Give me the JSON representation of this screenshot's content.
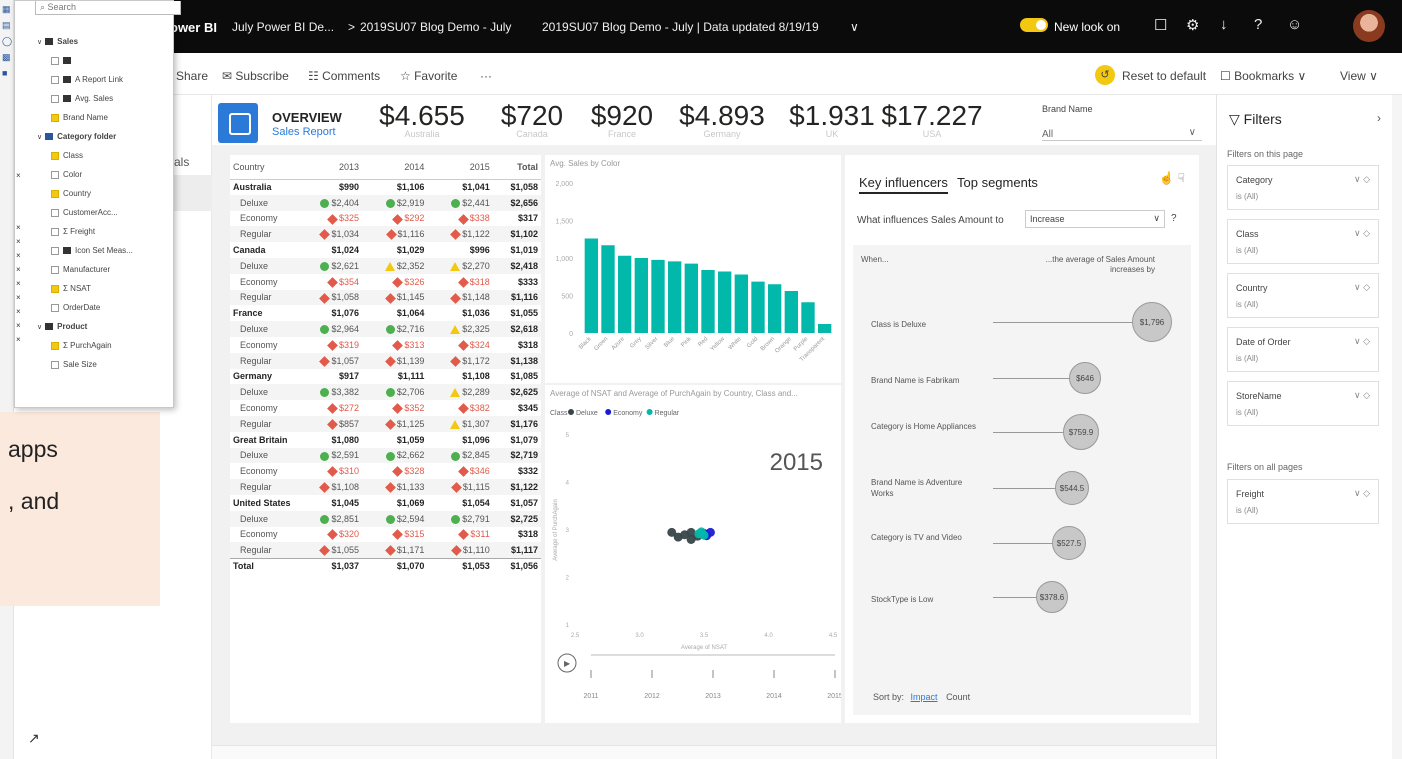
{
  "topbar": {
    "brand": "ower BI",
    "crumb1": "July Power BI De...",
    "crumb_sep": ">",
    "crumb2": "2019SU07 Blog Demo - July",
    "report_title": "2019SU07 Blog Demo - July | Data updated 8/19/19",
    "title_chevron": "∨",
    "new_look": "New look on",
    "icons": [
      "chat-icon",
      "gear-icon",
      "download-icon",
      "help-icon",
      "smiley-icon"
    ],
    "icon_glyphs": [
      "☐",
      "⚙",
      "↓",
      "?",
      "☺"
    ]
  },
  "actionbar": {
    "share": "Share",
    "subscribe": "✉ Subscribe",
    "comments": "☷ Comments",
    "favorite": "☆ Favorite",
    "more": "···",
    "reset_icon": "↺",
    "reset": "Reset to default",
    "bookmarks": "☐ Bookmarks ∨",
    "view": "View ∨"
  },
  "rail": {
    "partial_label": "als",
    "corner_arrow": "↗"
  },
  "fields_pane": {
    "search_placeholder": "⌕ Search",
    "rows": [
      {
        "label": "Sales",
        "kind": "table-header",
        "check": "none"
      },
      {
        "label": "",
        "kind": "item",
        "check": "table"
      },
      {
        "label": "A Report Link",
        "kind": "item",
        "check": "table"
      },
      {
        "label": "Avg. Sales",
        "kind": "item",
        "check": "table"
      },
      {
        "label": "Brand Name",
        "kind": "item",
        "check": "on"
      },
      {
        "label": "Category folder",
        "kind": "folder",
        "check": "none"
      },
      {
        "label": "Class",
        "kind": "item",
        "check": "on"
      },
      {
        "label": "Color",
        "kind": "item",
        "check": "off"
      },
      {
        "label": "Country",
        "kind": "item",
        "check": "on"
      },
      {
        "label": "CustomerAcc...",
        "kind": "item",
        "check": "off"
      },
      {
        "label": "Σ Freight",
        "kind": "item",
        "check": "off"
      },
      {
        "label": "Icon Set Meas...",
        "kind": "item",
        "check": "table"
      },
      {
        "label": "Manufacturer",
        "kind": "item",
        "check": "off"
      },
      {
        "label": "Σ NSAT",
        "kind": "item",
        "check": "on"
      },
      {
        "label": "OrderDate",
        "kind": "item",
        "check": "off"
      },
      {
        "label": "Product",
        "kind": "table-header",
        "check": "none"
      },
      {
        "label": "Σ PurchAgain",
        "kind": "item",
        "check": "on"
      },
      {
        "label": "Sale Size",
        "kind": "item",
        "check": "off"
      }
    ]
  },
  "beige_card": {
    "lines": [
      "apps",
      ", and"
    ]
  },
  "header": {
    "title": "OVERVIEW",
    "subtitle": "Sales Report",
    "kpis": [
      {
        "value": "$4.655",
        "label": "Australia"
      },
      {
        "value": "$720",
        "label": "Canada"
      },
      {
        "value": "$920",
        "label": "France"
      },
      {
        "value": "$4.893",
        "label": "Germany"
      },
      {
        "value": "$1.931",
        "label": "UK"
      },
      {
        "value": "$17.227",
        "label": "USA"
      }
    ],
    "brand_label": "Brand Name",
    "brand_value": "All",
    "brand_chevron": "∨"
  },
  "matrix": {
    "headers": [
      "Country",
      "2013",
      "2014",
      "2015",
      "Total"
    ],
    "rows": [
      {
        "type": "country",
        "cells": [
          "Australia",
          "$990",
          "$1,106",
          "$1,041",
          "$1,058"
        ]
      },
      {
        "type": "sub",
        "cells": [
          "Deluxe",
          "$2,404",
          "$2,919",
          "$2,441",
          "$2,656"
        ],
        "icons": [
          "g",
          "g",
          "g"
        ]
      },
      {
        "type": "sub",
        "cells": [
          "Economy",
          "$325",
          "$292",
          "$338",
          "$317"
        ],
        "icons": [
          "r",
          "r",
          "r"
        ]
      },
      {
        "type": "sub",
        "cells": [
          "Regular",
          "$1,034",
          "$1,116",
          "$1,122",
          "$1,102"
        ],
        "icons": [
          "r",
          "r",
          "r"
        ]
      },
      {
        "type": "country",
        "cells": [
          "Canada",
          "$1,024",
          "$1,029",
          "$996",
          "$1,019"
        ]
      },
      {
        "type": "sub",
        "cells": [
          "Deluxe",
          "$2,621",
          "$2,352",
          "$2,270",
          "$2,418"
        ],
        "icons": [
          "g",
          "y",
          "y"
        ]
      },
      {
        "type": "sub",
        "cells": [
          "Economy",
          "$354",
          "$326",
          "$318",
          "$333"
        ],
        "icons": [
          "r",
          "r",
          "r"
        ]
      },
      {
        "type": "sub",
        "cells": [
          "Regular",
          "$1,058",
          "$1,145",
          "$1,148",
          "$1,116"
        ],
        "icons": [
          "r",
          "r",
          "r"
        ]
      },
      {
        "type": "country",
        "cells": [
          "France",
          "$1,076",
          "$1,064",
          "$1,036",
          "$1,055"
        ]
      },
      {
        "type": "sub",
        "cells": [
          "Deluxe",
          "$2,964",
          "$2,716",
          "$2,325",
          "$2,618"
        ],
        "icons": [
          "g",
          "g",
          "y"
        ]
      },
      {
        "type": "sub",
        "cells": [
          "Economy",
          "$319",
          "$313",
          "$324",
          "$318"
        ],
        "icons": [
          "r",
          "r",
          "r"
        ]
      },
      {
        "type": "sub",
        "cells": [
          "Regular",
          "$1,057",
          "$1,139",
          "$1,172",
          "$1,138"
        ],
        "icons": [
          "r",
          "r",
          "r"
        ]
      },
      {
        "type": "country",
        "cells": [
          "Germany",
          "$917",
          "$1,111",
          "$1,108",
          "$1,085"
        ]
      },
      {
        "type": "sub",
        "cells": [
          "Deluxe",
          "$3,382",
          "$2,706",
          "$2,289",
          "$2,625"
        ],
        "icons": [
          "g",
          "g",
          "y"
        ]
      },
      {
        "type": "sub",
        "cells": [
          "Economy",
          "$272",
          "$352",
          "$382",
          "$345"
        ],
        "icons": [
          "r",
          "r",
          "r"
        ]
      },
      {
        "type": "sub",
        "cells": [
          "Regular",
          "$857",
          "$1,125",
          "$1,307",
          "$1,176"
        ],
        "icons": [
          "r",
          "r",
          "y"
        ]
      },
      {
        "type": "country",
        "cells": [
          "Great Britain",
          "$1,080",
          "$1,059",
          "$1,096",
          "$1,079"
        ]
      },
      {
        "type": "sub",
        "cells": [
          "Deluxe",
          "$2,591",
          "$2,662",
          "$2,845",
          "$2,719"
        ],
        "icons": [
          "g",
          "g",
          "g"
        ]
      },
      {
        "type": "sub",
        "cells": [
          "Economy",
          "$310",
          "$328",
          "$346",
          "$332"
        ],
        "icons": [
          "r",
          "r",
          "r"
        ]
      },
      {
        "type": "sub",
        "cells": [
          "Regular",
          "$1,108",
          "$1,133",
          "$1,115",
          "$1,122"
        ],
        "icons": [
          "r",
          "r",
          "r"
        ]
      },
      {
        "type": "country",
        "cells": [
          "United States",
          "$1,045",
          "$1,069",
          "$1,054",
          "$1,057"
        ]
      },
      {
        "type": "sub",
        "cells": [
          "Deluxe",
          "$2,851",
          "$2,594",
          "$2,791",
          "$2,725"
        ],
        "icons": [
          "g",
          "g",
          "g"
        ]
      },
      {
        "type": "sub",
        "cells": [
          "Economy",
          "$320",
          "$315",
          "$311",
          "$318"
        ],
        "icons": [
          "r",
          "r",
          "r"
        ]
      },
      {
        "type": "sub",
        "cells": [
          "Regular",
          "$1,055",
          "$1,171",
          "$1,110",
          "$1,117"
        ],
        "icons": [
          "r",
          "r",
          "r"
        ]
      },
      {
        "type": "grand",
        "cells": [
          "Total",
          "$1,037",
          "$1,070",
          "$1,053",
          "$1,056"
        ]
      }
    ]
  },
  "chart_data": [
    {
      "type": "bar",
      "title": "Avg. Sales by Color",
      "categories": [
        "Black",
        "Green",
        "Azure",
        "Grey",
        "Silver",
        "Blue",
        "Pink",
        "Red",
        "Yellow",
        "White",
        "Gold",
        "Brown",
        "Orange",
        "Purple",
        "Transparent"
      ],
      "values": [
        1260,
        1170,
        1030,
        1000,
        975,
        955,
        925,
        840,
        820,
        780,
        685,
        650,
        560,
        410,
        120
      ],
      "ylim": [
        0,
        2000
      ],
      "yticks": [
        "0",
        "500",
        "1,000",
        "1,500",
        "2,000"
      ],
      "color": "#01b8aa"
    },
    {
      "type": "scatter",
      "title": "Average of NSAT and Average of PurchAgain by Country, Class and...",
      "legend_title": "Class",
      "legend": [
        {
          "name": "Deluxe",
          "color": "#374649"
        },
        {
          "name": "Economy",
          "color": "#1b1bd1"
        },
        {
          "name": "Regular",
          "color": "#01b8aa"
        }
      ],
      "play_year": "2015",
      "xlabel": "Average of NSAT",
      "ylabel": "Average of PurchAgain",
      "xlim": [
        2.5,
        4.5
      ],
      "ylim": [
        1,
        5
      ],
      "xticks": [
        "2.5",
        "3.0",
        "3.5",
        "4.0",
        "4.5"
      ],
      "yticks": [
        "1",
        "2",
        "3",
        "4",
        "5"
      ],
      "points": [
        {
          "x": 3.25,
          "y": 2.95,
          "c": "Deluxe"
        },
        {
          "x": 3.3,
          "y": 2.85,
          "c": "Deluxe"
        },
        {
          "x": 3.35,
          "y": 2.9,
          "c": "Deluxe"
        },
        {
          "x": 3.4,
          "y": 2.8,
          "c": "Deluxe"
        },
        {
          "x": 3.45,
          "y": 2.87,
          "c": "Deluxe"
        },
        {
          "x": 3.4,
          "y": 2.95,
          "c": "Deluxe"
        },
        {
          "x": 3.5,
          "y": 2.93,
          "c": "Economy"
        },
        {
          "x": 3.55,
          "y": 2.95,
          "c": "Economy"
        },
        {
          "x": 3.52,
          "y": 2.88,
          "c": "Economy"
        },
        {
          "x": 3.48,
          "y": 2.96,
          "c": "Regular"
        },
        {
          "x": 3.46,
          "y": 2.92,
          "c": "Regular"
        },
        {
          "x": 3.5,
          "y": 2.89,
          "c": "Regular"
        }
      ],
      "timeline": [
        "2011",
        "2012",
        "2013",
        "2014",
        "2015"
      ],
      "play_icon": "▶"
    }
  ],
  "key_influencers": {
    "tab1": "Key influencers",
    "tab2": "Top segments",
    "thumbs": "☝ ☟",
    "question": "What influences Sales Amount to",
    "dropdown_value": "Increase",
    "dropdown_chevron": "∨",
    "help": "?",
    "when": "When...",
    "avg_text": "...the average of Sales Amount increases by",
    "rows": [
      {
        "label": "Class is Deluxe",
        "value": "$1,796"
      },
      {
        "label": "Brand Name is Fabrikam",
        "value": "$646"
      },
      {
        "label": "Category is Home Appliances",
        "value": "$759.9"
      },
      {
        "label": "Brand Name is Adventure Works",
        "value": "$544.5"
      },
      {
        "label": "Category is TV and Video",
        "value": "$527.5"
      },
      {
        "label": "StockType is Low",
        "value": "$378.6"
      }
    ],
    "sort_label": "Sort by:",
    "sort_impact": "Impact",
    "sort_count": "Count"
  },
  "filters": {
    "title": "▽ Filters",
    "collapse_chevron": "›",
    "on_page_label": "Filters on this page",
    "on_all_label": "Filters on all pages",
    "card_icons": "∨ ◇",
    "page_filters": [
      {
        "name": "Category",
        "state": "is (All)"
      },
      {
        "name": "Class",
        "state": "is (All)"
      },
      {
        "name": "Country",
        "state": "is (All)"
      },
      {
        "name": "Date of Order",
        "state": "is (All)"
      },
      {
        "name": "StoreName",
        "state": "is (All)"
      }
    ],
    "all_filters": [
      {
        "name": "Freight",
        "state": "is (All)"
      }
    ]
  }
}
